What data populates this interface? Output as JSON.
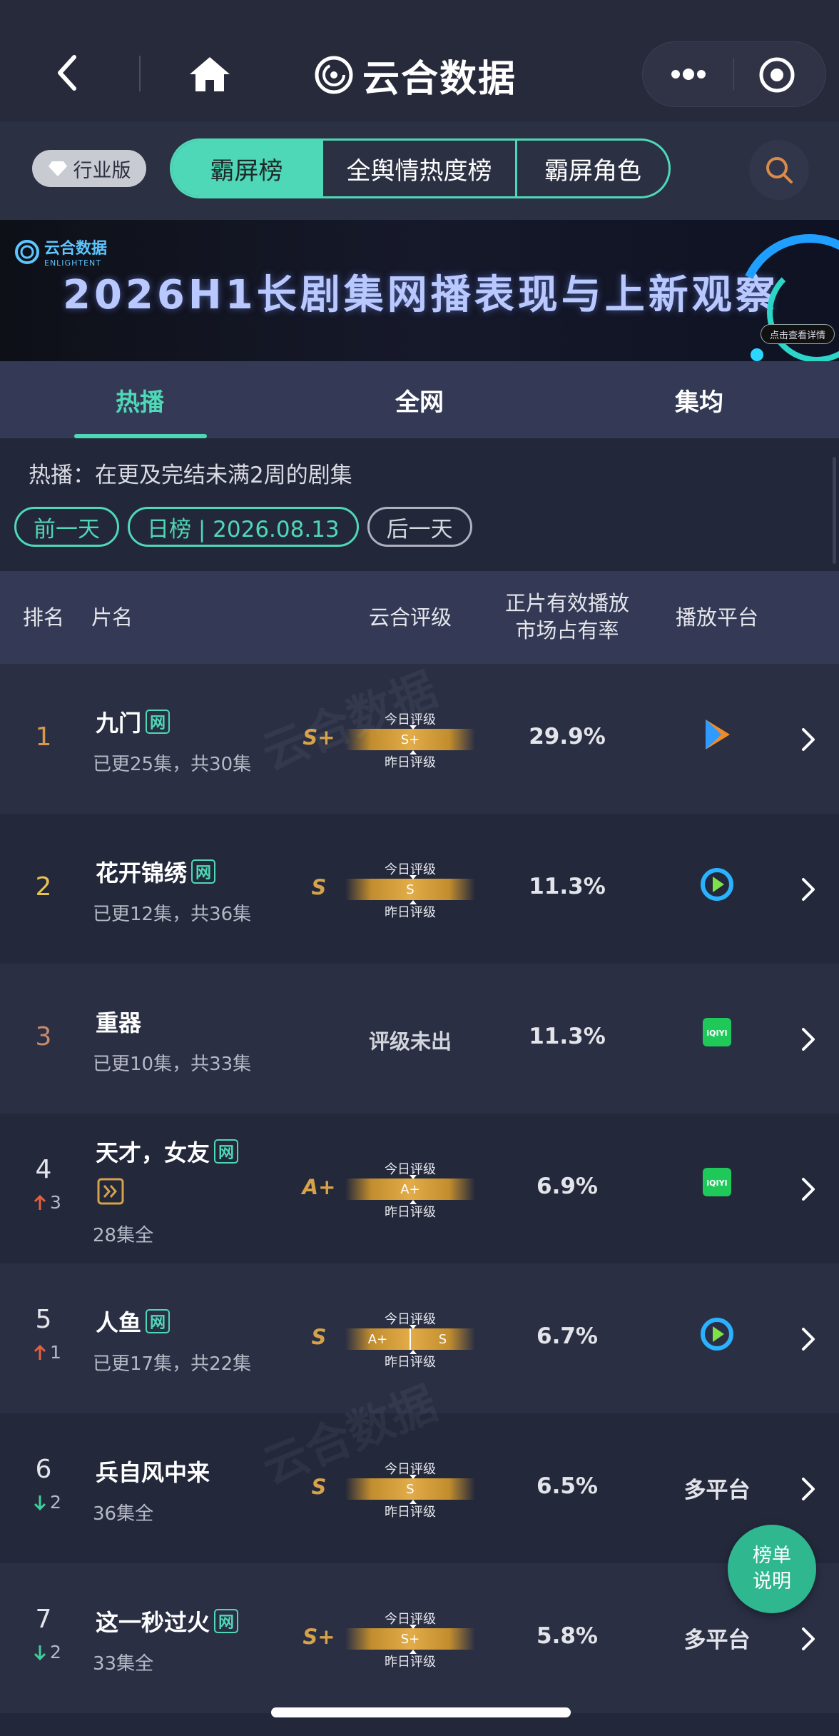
{
  "app": {
    "title": "云合数据"
  },
  "tabs": {
    "edition_badge": "行业版",
    "items": [
      "霸屏榜",
      "全舆情热度榜",
      "霸屏角色"
    ],
    "active_index": 0
  },
  "banner": {
    "logo_cn": "云合数据",
    "logo_en": "ENLIGHTENT",
    "title": "2026H1长剧集网播表现与上新观察",
    "cta": "点击查看详情"
  },
  "subtabs": {
    "items": [
      "热播",
      "全网",
      "集均"
    ],
    "active_index": 0
  },
  "description": "热播：在更及完结未满2周的剧集",
  "date_nav": {
    "prev": "前一天",
    "current": "日榜 | 2026.08.13",
    "next": "后一天"
  },
  "table": {
    "headers": {
      "rank": "排名",
      "title": "片名",
      "rating": "云合评级",
      "share_line1": "正片有效播放",
      "share_line2": "市场占有率",
      "platform": "播放平台"
    },
    "rating_labels": {
      "today": "今日评级",
      "yesterday": "昨日评级"
    },
    "rows": [
      {
        "rank": "1",
        "title": "九门",
        "tag": "网",
        "extra_icon": "",
        "episodes": "已更25集，共30集",
        "grade": "S+",
        "bar_text": "S+",
        "bar_split": "",
        "unrated": "",
        "share": "29.9%",
        "platform": "tencent-video-icon",
        "platform_text": "",
        "change_dir": "",
        "change": "",
        "rank_color": "#d69a4d"
      },
      {
        "rank": "2",
        "title": "花开锦绣",
        "tag": "网",
        "extra_icon": "",
        "episodes": "已更12集，共36集",
        "grade": "S",
        "bar_text": "S",
        "bar_split": "",
        "unrated": "",
        "share": "11.3%",
        "platform": "youku-icon",
        "platform_text": "",
        "change_dir": "",
        "change": "",
        "rank_color": "#e8c24e"
      },
      {
        "rank": "3",
        "title": "重器",
        "tag": "",
        "extra_icon": "",
        "episodes": "已更10集，共33集",
        "grade": "",
        "bar_text": "",
        "bar_split": "",
        "unrated": "评级未出",
        "share": "11.3%",
        "platform": "iqiyi-icon",
        "platform_text": "",
        "change_dir": "",
        "change": "",
        "rank_color": "#c78b6a"
      },
      {
        "rank": "4",
        "title": "天才，女友",
        "tag": "网",
        "extra_icon": "micro-drama-icon",
        "episodes": "28集全",
        "grade": "A+",
        "bar_text": "A+",
        "bar_split": "",
        "unrated": "",
        "share": "6.9%",
        "platform": "iqiyi-icon",
        "platform_text": "",
        "change_dir": "up",
        "change": "3",
        "rank_color": "#e4e5ea"
      },
      {
        "rank": "5",
        "title": "人鱼",
        "tag": "网",
        "extra_icon": "",
        "episodes": "已更17集，共22集",
        "grade": "S",
        "bar_text": "A+",
        "bar_split": "S",
        "unrated": "",
        "share": "6.7%",
        "platform": "youku-icon",
        "platform_text": "",
        "change_dir": "up",
        "change": "1",
        "rank_color": "#e4e5ea"
      },
      {
        "rank": "6",
        "title": "兵自风中来",
        "tag": "",
        "extra_icon": "",
        "episodes": "36集全",
        "grade": "S",
        "bar_text": "S",
        "bar_split": "",
        "unrated": "",
        "share": "6.5%",
        "platform": "",
        "platform_text": "多平台",
        "change_dir": "down",
        "change": "2",
        "rank_color": "#e4e5ea"
      },
      {
        "rank": "7",
        "title": "这一秒过火",
        "tag": "网",
        "extra_icon": "",
        "episodes": "33集全",
        "grade": "S+",
        "bar_text": "S+",
        "bar_split": "",
        "unrated": "",
        "share": "5.8%",
        "platform": "",
        "platform_text": "多平台",
        "change_dir": "down",
        "change": "2",
        "rank_color": "#e4e5ea"
      }
    ]
  },
  "float_button": {
    "line1": "榜单",
    "line2": "说明"
  },
  "colors": {
    "accent": "#4fd8b7",
    "gold": "#d6a24a",
    "up": "#e5603f",
    "down": "#3fcf9a"
  }
}
